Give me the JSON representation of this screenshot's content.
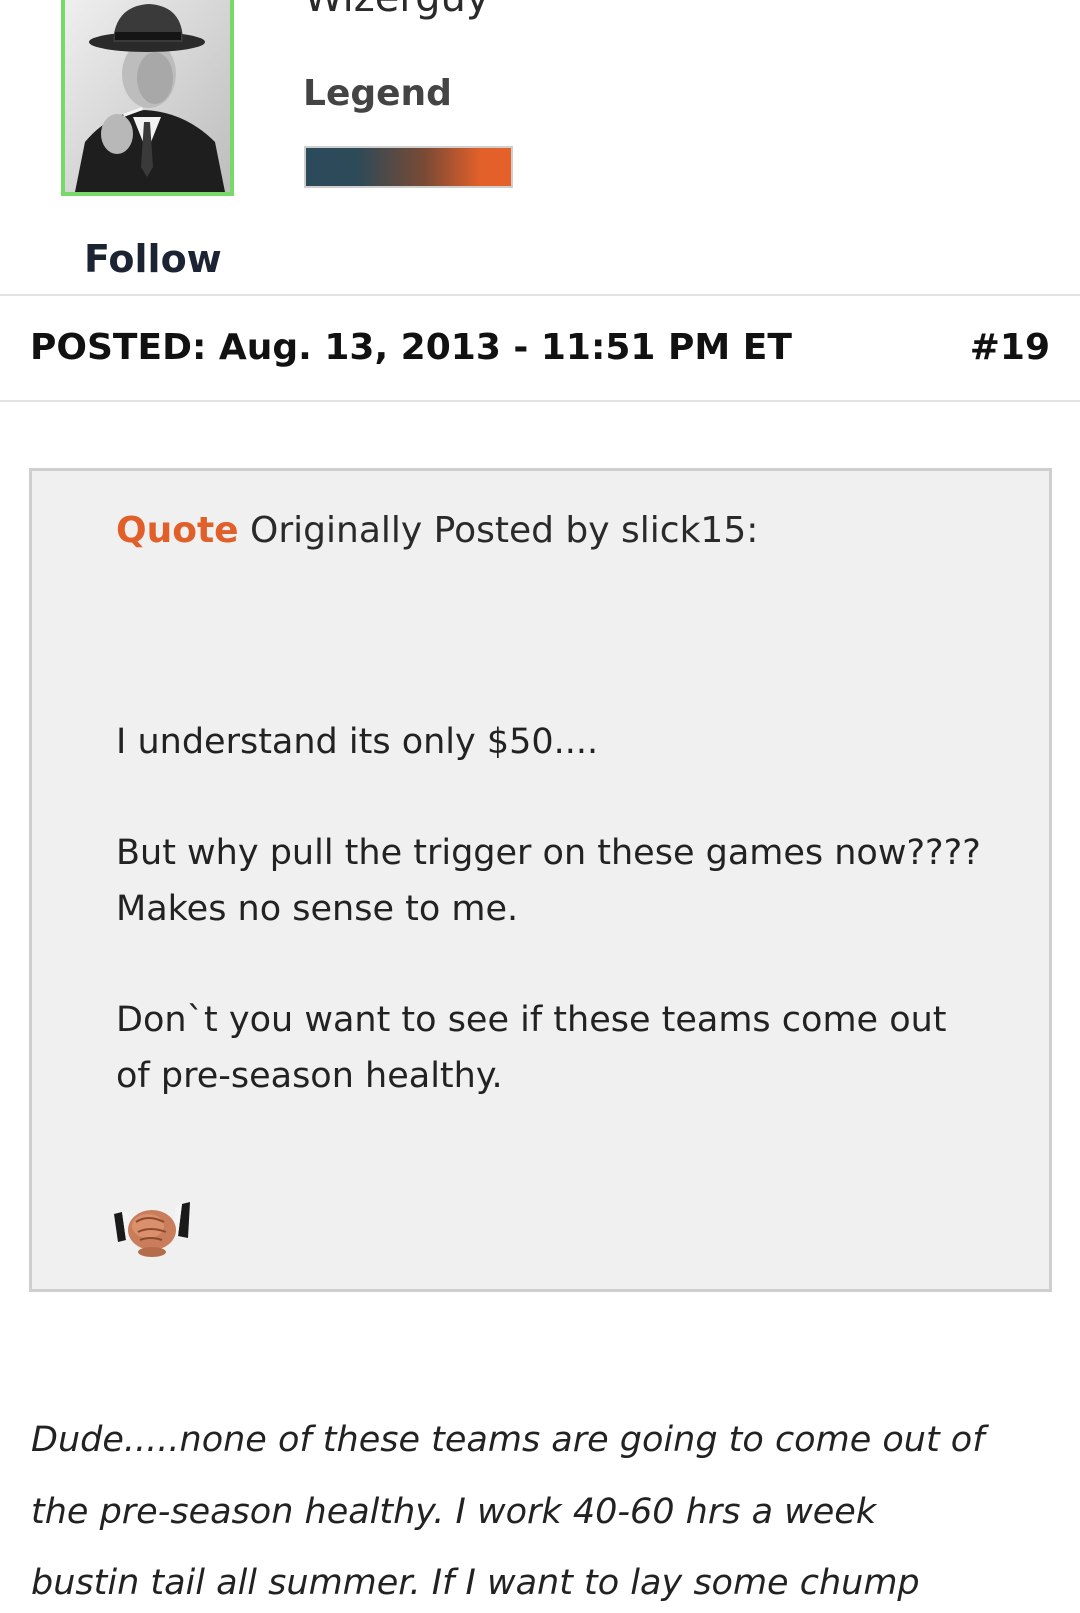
{
  "profile": {
    "username": "Wizerguy",
    "rank": "Legend",
    "follow_label": "Follow",
    "rank_bar_colors": [
      "#2b4a5a",
      "#e6612a"
    ],
    "avatar_border_color": "#77d96a",
    "avatar_icon": "avatar-photo"
  },
  "post": {
    "posted_label": "POSTED:",
    "posted_date": "Aug. 13, 2013 - 11:51 PM ET",
    "post_number": "#19"
  },
  "quote": {
    "label": "Quote",
    "attribution": "Originally Posted by slick15:",
    "lines": [
      "I understand its only $50....",
      "But why pull the trigger on these games now????",
      "Makes no sense to me.",
      "Don`t you want to see if these teams come out",
      "of pre-season healthy."
    ],
    "emoji_icon": "handshake-icon",
    "accent_color": "#e1602a"
  },
  "reply": {
    "lines": [
      "Dude.....none of these teams are going to come out of",
      "the pre-season healthy.  I work 40-60 hrs a week",
      "bustin tail all summer. If I want to lay some chump"
    ]
  }
}
